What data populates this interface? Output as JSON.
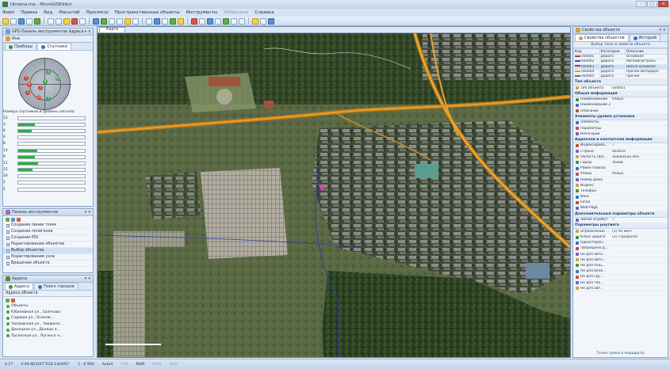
{
  "window": {
    "title": "Ukraina.mp - MicroGISEditor",
    "controls": [
      "–",
      "□",
      "×"
    ]
  },
  "menu": [
    "Файл",
    "Правка",
    "Вид",
    "Масштаб",
    "Просмотр",
    "Пространственные объекты",
    "Инструменты",
    "Избранное",
    "Справка"
  ],
  "menu_disabled_index": 7,
  "gps_panel": {
    "title": "GPS-Панель инструментов Адреса",
    "sub_title": "Ини",
    "tabs": [
      "Приборы",
      "Спутники"
    ],
    "active_tab": 1,
    "satellites": [
      {
        "id": "1",
        "color": "red"
      },
      {
        "id": "9",
        "color": "red"
      },
      {
        "id": "3",
        "color": "red"
      },
      {
        "id": "4",
        "color": "green"
      },
      {
        "id": "8",
        "color": "green"
      },
      {
        "id": "2",
        "color": "red"
      },
      {
        "id": "14",
        "color": "green"
      },
      {
        "id": "12",
        "color": "red"
      },
      {
        "id": "7",
        "color": "green"
      }
    ],
    "snr_title": "Номера спутников и уровень сигнала",
    "snr": [
      {
        "id": "22",
        "level": 0.0
      },
      {
        "id": "3",
        "level": 0.25
      },
      {
        "id": "6",
        "level": 0.2
      },
      {
        "id": "4",
        "level": 0.0
      },
      {
        "id": "8",
        "level": 0.0
      },
      {
        "id": "14",
        "level": 0.28
      },
      {
        "id": "9",
        "level": 0.25
      },
      {
        "id": "11",
        "level": 0.3
      },
      {
        "id": "15",
        "level": 0.22
      },
      {
        "id": "16",
        "level": 0.0
      },
      {
        "id": "1",
        "level": 0.0
      },
      {
        "id": "5",
        "level": 0.0
      }
    ]
  },
  "tools_panel": {
    "title": "Панель инструментов",
    "items": [
      "Создание линии точек",
      "Создание полигонов",
      "Создание POI",
      "Редактирование объектов",
      "Выбор объектов",
      "Редактирование узла",
      "Вращение объекта"
    ],
    "selected": 4
  },
  "address_panel": {
    "title": "Адреса",
    "tabs": [
      "Адреса",
      "Поиск городов"
    ],
    "search_label": "Адреса объекта",
    "items": [
      "Объекты",
      "Юбилейная ул., Святково",
      "Садовая ул., Осипов...",
      "Чапаевская ул., Червоног...",
      "Донецкая ул., Донецк я...",
      "Луганская ул., Луганск я..."
    ]
  },
  "map": {
    "tab_label": "Карта"
  },
  "props_panel": {
    "title": "Свойства объекта",
    "tabs": [
      "Свойства объектов",
      "Историй"
    ],
    "type_choice": "Выбор типа и свойств объекта",
    "columns": [
      "Код",
      "Категория",
      "Описание"
    ],
    "rows": [
      {
        "code": "0x0001",
        "cat": "Дорога",
        "desc": "Основная",
        "color": "#d02a2a"
      },
      {
        "code": "0x0002",
        "cat": "Дорога",
        "desc": "Автомагистраль",
        "color": "#1a55c8"
      },
      {
        "code": "0x0003",
        "cat": "Дорога",
        "desc": "Шоссе основное",
        "color": "#d02a2a"
      },
      {
        "code": "0x0004",
        "cat": "Дорога",
        "desc": "Прочее автодорог",
        "color": "#e8a020"
      },
      {
        "code": "0x0005",
        "cat": "Дорога",
        "desc": "Прочие",
        "color": "#666666"
      }
    ],
    "selected_row": 2,
    "sections": [
      {
        "title": "Тип объекта",
        "props": [
          {
            "n": "Тип объекта",
            "v": "0x0001"
          }
        ]
      },
      {
        "title": "Общая информация",
        "props": [
          {
            "n": "Наименование",
            "v": "Улица"
          },
          {
            "n": "Наименование 2",
            "v": ""
          },
          {
            "n": "Описание",
            "v": ""
          }
        ]
      },
      {
        "title": "Элементы уровня установки",
        "props": [
          {
            "n": "Элементы",
            "v": ""
          },
          {
            "n": "Параметры",
            "v": ""
          },
          {
            "n": "Категория",
            "v": ""
          }
        ]
      },
      {
        "title": "Адресная и контактная информация",
        "props": [
          {
            "n": "Индексирова...",
            "v": "✓"
          },
          {
            "n": "Страна",
            "v": "Ukraine"
          },
          {
            "n": "Область Пре...",
            "v": "Львовська обл."
          },
          {
            "n": "Город",
            "v": "Львов"
          },
          {
            "n": "Район поиска",
            "v": ""
          },
          {
            "n": "Улица",
            "v": "Улица"
          },
          {
            "n": "Номер дома",
            "v": ""
          },
          {
            "n": "Индекс",
            "v": ""
          },
          {
            "n": "Телефон",
            "v": ""
          },
          {
            "n": "Факс",
            "v": ""
          },
          {
            "n": "Email",
            "v": ""
          },
          {
            "n": "Web-Page",
            "v": ""
          }
        ]
      },
      {
        "title": "Дополнительные параметры объекта",
        "props": [
          {
            "n": "Линия атрибут",
            "v": "✓"
          }
        ]
      },
      {
        "title": "Параметры роутинга",
        "props": [
          {
            "n": "Ограничение ...",
            "v": "(3) 50 км/ч"
          },
          {
            "n": "Класс дороги",
            "v": "(2) Городская"
          },
          {
            "n": "Односторон...",
            "v": ""
          },
          {
            "n": "Запрещено д...",
            "v": ""
          },
          {
            "n": "Не для авто...",
            "v": ""
          },
          {
            "n": "Не для авто...",
            "v": ""
          },
          {
            "n": "Не для пеш...",
            "v": ""
          },
          {
            "n": "Не для вело...",
            "v": ""
          },
          {
            "n": "Не для гру...",
            "v": ""
          },
          {
            "n": "Не для так...",
            "v": ""
          },
          {
            "n": "Не для авт...",
            "v": ""
          }
        ]
      }
    ],
    "bottom_link": "Точки трека и маршруты"
  },
  "status": {
    "tool": "0.17",
    "coords": "X:49.863167°E24.142492°",
    "scale": "1 : 6 900",
    "zoom": "Auto4",
    "indicators": [
      "CAP",
      "NUM",
      "SCRL",
      "OVR"
    ]
  }
}
